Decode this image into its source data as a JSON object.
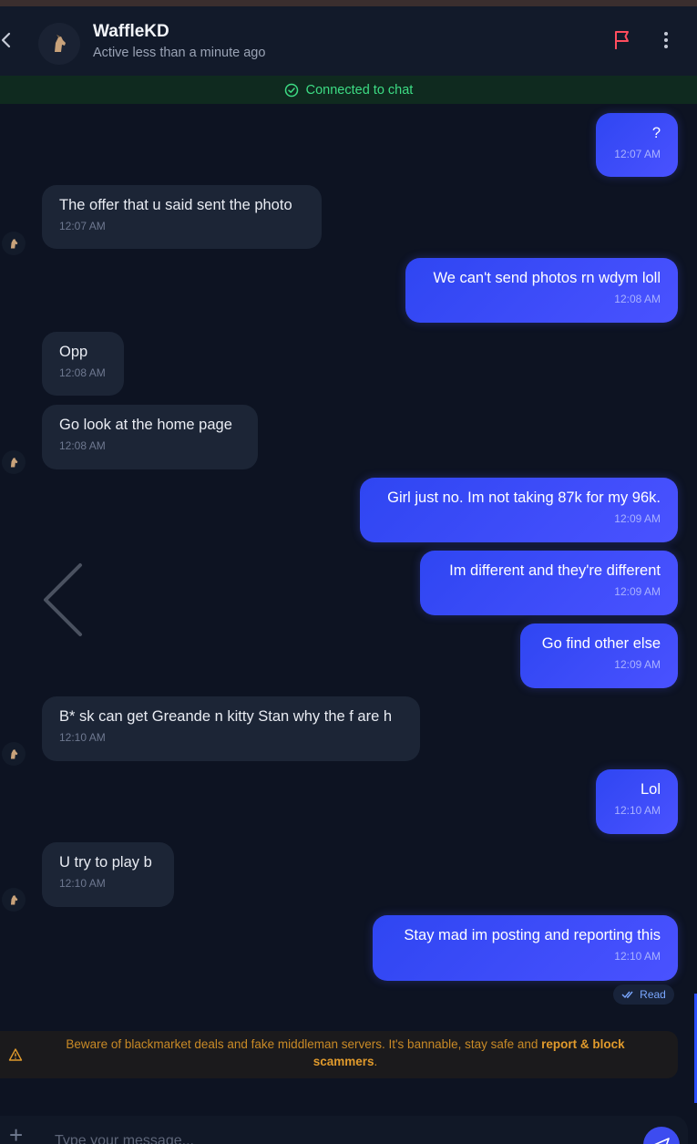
{
  "header": {
    "name": "WaffleKD",
    "presence": "Active less than a minute ago"
  },
  "status": {
    "text": "Connected to chat",
    "color": "#3ddc84"
  },
  "messages": [
    {
      "dir": "out",
      "text": "?",
      "time": "12:07 AM"
    },
    {
      "dir": "in",
      "text": "The offer that u said sent the photo",
      "time": "12:07 AM"
    },
    {
      "dir": "out",
      "text": "We can't send photos rn wdym loll",
      "time": "12:08 AM"
    },
    {
      "dir": "in",
      "text": "Opp",
      "time": "12:08 AM"
    },
    {
      "dir": "in",
      "text": "Go look at the home page",
      "time": "12:08 AM"
    },
    {
      "dir": "out",
      "text": "Girl just no. Im not taking 87k for my 96k.",
      "time": "12:09 AM"
    },
    {
      "dir": "out",
      "text": "Im different and they're different",
      "time": "12:09 AM"
    },
    {
      "dir": "out",
      "text": "Go find other else",
      "time": "12:09 AM"
    },
    {
      "dir": "in",
      "text": "B* sk can get Greande n kitty Stan why the f are h",
      "time": "12:10 AM"
    },
    {
      "dir": "out",
      "text": "Lol",
      "time": "12:10 AM"
    },
    {
      "dir": "in",
      "text": "U try to play b",
      "time": "12:10 AM"
    },
    {
      "dir": "out",
      "text": "Stay mad im posting and reporting this",
      "time": "12:10 AM"
    }
  ],
  "read_receipt": "Read",
  "warning": {
    "text": "Beware of blackmarket deals and fake middleman servers. It's bannable, stay safe and ",
    "bold": "report & block scammers",
    "end": "."
  },
  "composer": {
    "placeholder": "Type your message..."
  },
  "colors": {
    "accent": "#3d4cf0",
    "incoming_bubble": "#1c2536",
    "warning": "#c98a26",
    "flag": "#ff4d5e"
  }
}
